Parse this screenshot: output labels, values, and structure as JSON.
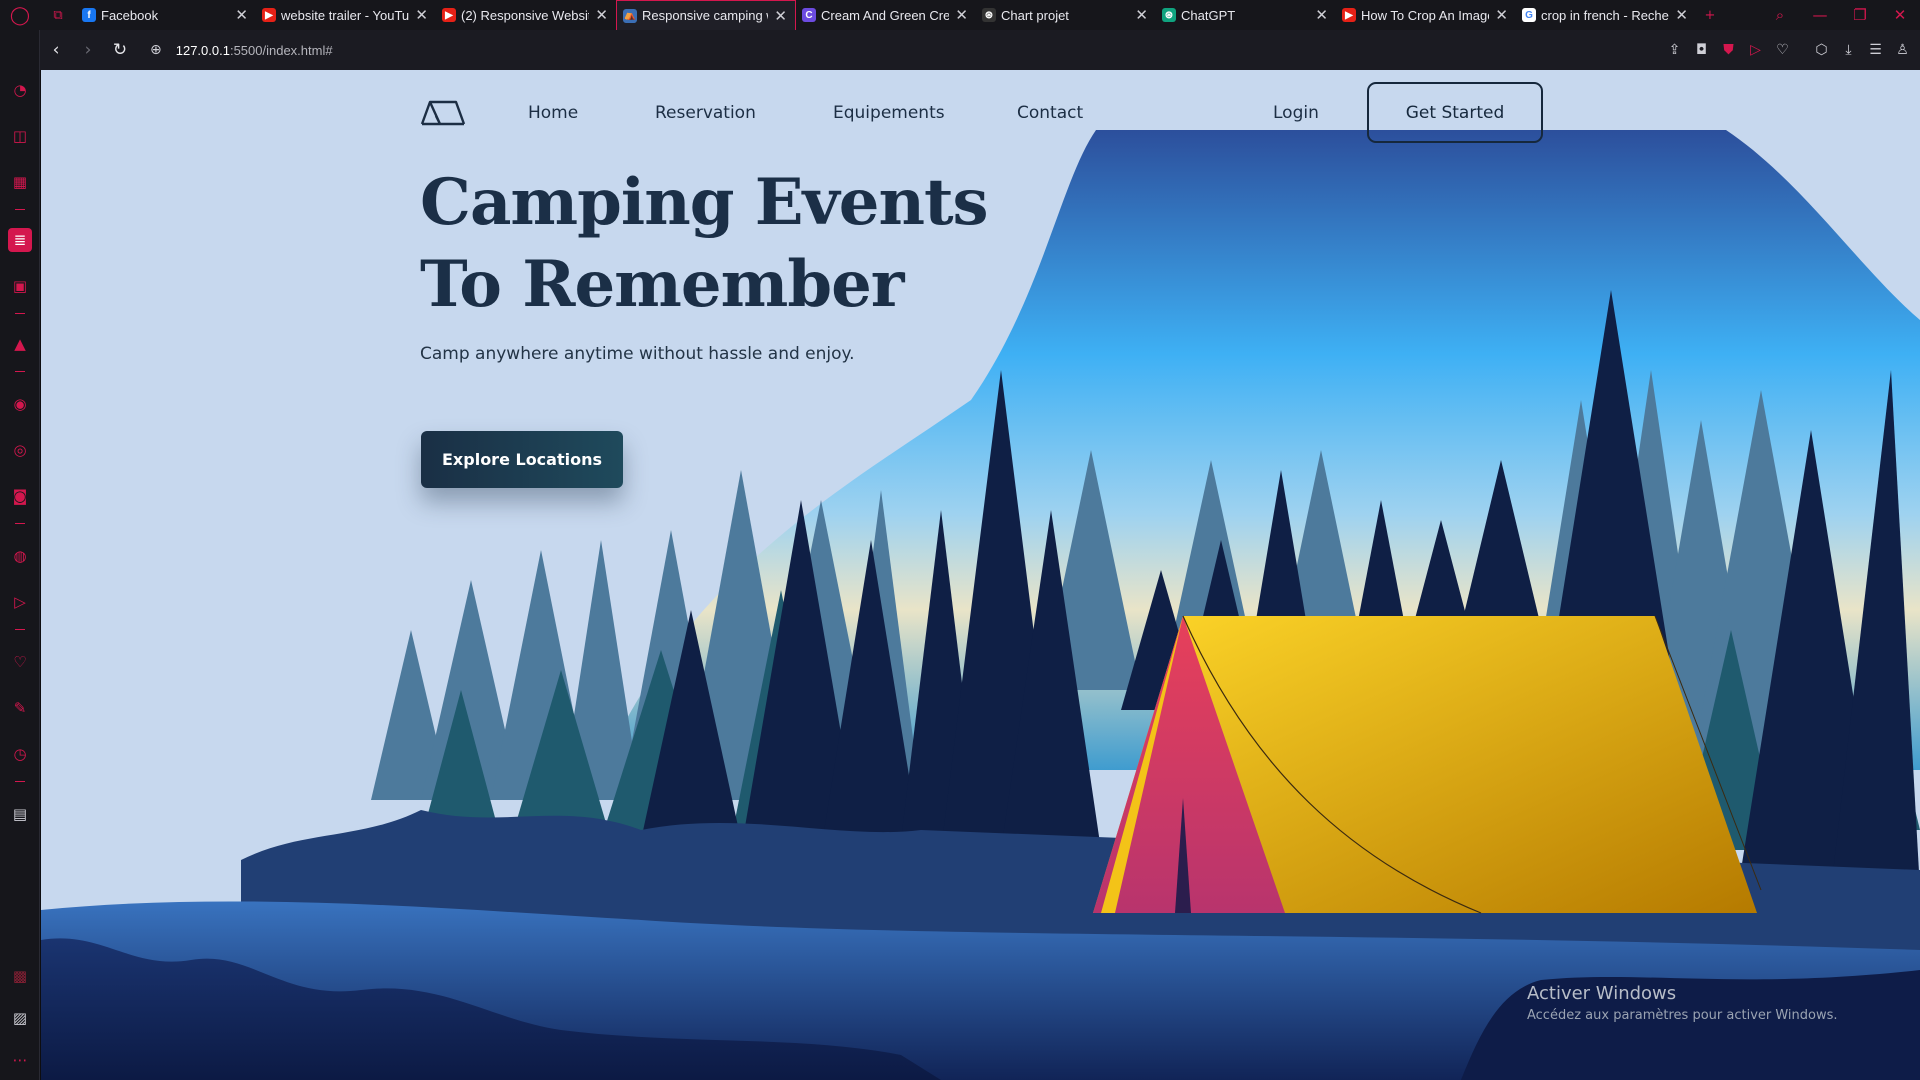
{
  "browser": {
    "tabs": [
      {
        "label": "Facebook",
        "favicon": "facebook-icon",
        "color": "#1877f2",
        "glyph": "f"
      },
      {
        "label": "website trailer - YouTub",
        "favicon": "youtube-icon",
        "color": "#e62117",
        "glyph": "▶"
      },
      {
        "label": "(2) Responsive Website",
        "favicon": "youtube-icon",
        "color": "#e62117",
        "glyph": "▶"
      },
      {
        "label": "Responsive camping we",
        "favicon": "tent-favicon",
        "color": "#3b6fb6",
        "glyph": "⛺",
        "active": true
      },
      {
        "label": "Cream And Green Creat",
        "favicon": "canva-icon",
        "color": "#6c4be0",
        "glyph": "C"
      },
      {
        "label": "Chart projet",
        "favicon": "openai-icon",
        "color": "#333",
        "glyph": "⊛"
      },
      {
        "label": "ChatGPT",
        "favicon": "chatgpt-icon",
        "color": "#10a37f",
        "glyph": "⊛"
      },
      {
        "label": "How To Crop An Image",
        "favicon": "youtube-icon",
        "color": "#e62117",
        "glyph": "▶"
      },
      {
        "label": "crop in french - Recherc",
        "favicon": "google-icon",
        "color": "#ffffff",
        "glyph": "G"
      }
    ],
    "url_host": "127.0.0.1",
    "url_rest": ":5500/index.html#"
  },
  "site": {
    "nav": {
      "home": "Home",
      "reservation": "Reservation",
      "equipements": "Equipements",
      "contact": "Contact",
      "login": "Login",
      "get_started": "Get Started"
    },
    "hero": {
      "title_line1": "Camping Events",
      "title_line2": "To Remember",
      "subtitle": "Camp anywhere anytime without hassle and enjoy.",
      "cta": "Explore Locations"
    }
  },
  "overlay": {
    "activate_title": "Activer Windows",
    "activate_sub": "Accédez aux paramètres pour activer Windows."
  },
  "colors": {
    "accent": "#d4174e",
    "tent_yellow": "#f1c21b",
    "tent_red": "#d8384f",
    "sky": "#3eb0f4",
    "page_bg": "#c7d8ee"
  }
}
